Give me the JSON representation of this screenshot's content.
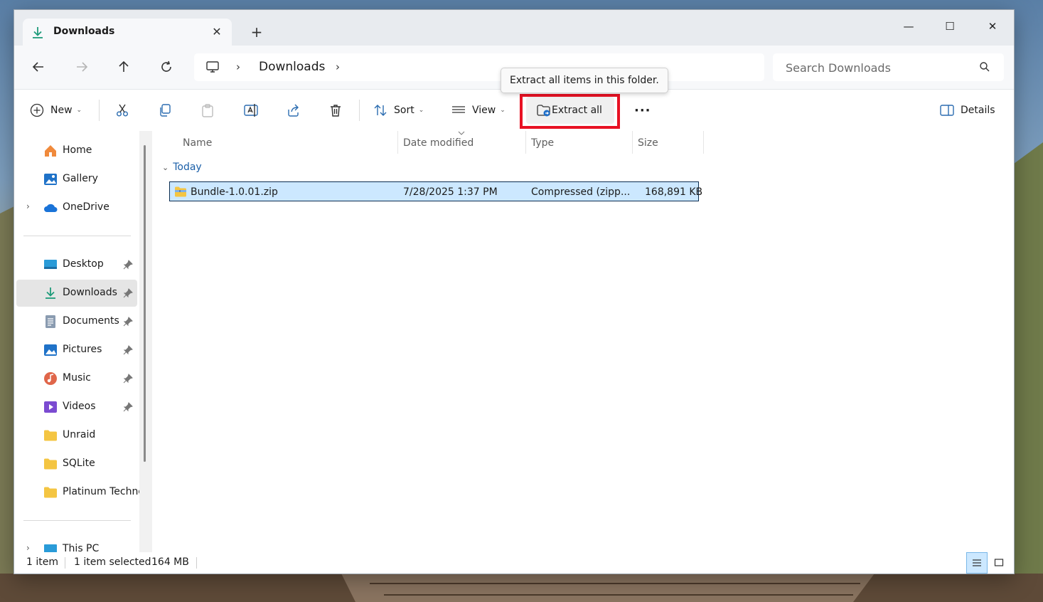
{
  "tab": {
    "title": "Downloads",
    "close_glyph": "✕",
    "new_glyph": "+"
  },
  "window_controls": {
    "minimize": "—",
    "maximize": "☐",
    "close": "✕"
  },
  "address": {
    "crumbs": [
      "Downloads"
    ],
    "chevron": "›"
  },
  "search": {
    "placeholder": "Search Downloads"
  },
  "commands": {
    "new": "New",
    "sort": "Sort",
    "view": "View",
    "extract_all": "Extract all",
    "more": "···",
    "details": "Details",
    "dropdown_glyph": "⌄"
  },
  "tooltip": {
    "text": "Extract all items in this folder."
  },
  "sidebar": {
    "top": [
      {
        "label": "Home",
        "icon": "home-icon"
      },
      {
        "label": "Gallery",
        "icon": "gallery-icon"
      },
      {
        "label": "OneDrive",
        "icon": "onedrive-icon",
        "expand": "›"
      }
    ],
    "quick": [
      {
        "label": "Desktop",
        "icon": "desktop-icon",
        "pinned": true
      },
      {
        "label": "Downloads",
        "icon": "download-icon",
        "pinned": true,
        "selected": true
      },
      {
        "label": "Documents",
        "icon": "documents-icon",
        "pinned": true
      },
      {
        "label": "Pictures",
        "icon": "pictures-icon",
        "pinned": true
      },
      {
        "label": "Music",
        "icon": "music-icon",
        "pinned": true
      },
      {
        "label": "Videos",
        "icon": "videos-icon",
        "pinned": true
      },
      {
        "label": "Unraid",
        "icon": "folder-icon"
      },
      {
        "label": "SQLite",
        "icon": "folder-icon"
      },
      {
        "label": "Platinum Techno",
        "icon": "folder-icon"
      }
    ],
    "bottom": [
      {
        "label": "This PC",
        "icon": "this-pc-icon",
        "expand": "›"
      }
    ]
  },
  "columns": {
    "name": "Name",
    "date": "Date modified",
    "type": "Type",
    "size": "Size"
  },
  "group": {
    "label": "Today",
    "chevron": "⌄"
  },
  "files": [
    {
      "name": "Bundle-1.0.01.zip",
      "date": "7/28/2025 1:37 PM",
      "type": "Compressed (zipp...",
      "size": "168,891 KB"
    }
  ],
  "status": {
    "count": "1 item",
    "selected": "1 item selected",
    "size": "164 MB"
  },
  "colors": {
    "accent": "#0067c0",
    "selection": "#cce8ff",
    "highlight": "#e81123"
  }
}
